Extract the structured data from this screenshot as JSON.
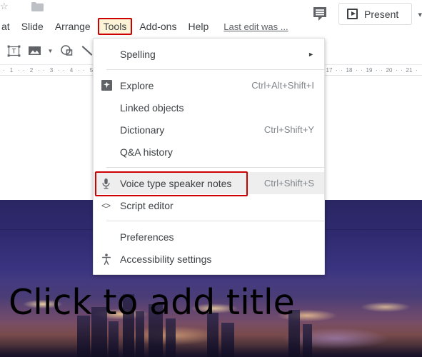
{
  "app": "Google Slides",
  "topbar": {
    "star_icon": "star-icon",
    "folder_icon": "folder-icon",
    "comment_icon": "comment-icon",
    "present_label": "Present",
    "present_icon": "play-button-icon",
    "present_caret": "▾"
  },
  "menubar": {
    "items": [
      {
        "label": "at",
        "name": "menu-format-clipped",
        "highlighted": false
      },
      {
        "label": "Slide",
        "name": "menu-slide",
        "highlighted": false
      },
      {
        "label": "Arrange",
        "name": "menu-arrange",
        "highlighted": false
      },
      {
        "label": "Tools",
        "name": "menu-tools",
        "highlighted": true
      },
      {
        "label": "Add-ons",
        "name": "menu-addons",
        "highlighted": false
      },
      {
        "label": "Help",
        "name": "menu-help",
        "highlighted": false
      }
    ],
    "last_edit": "Last edit was ..."
  },
  "toolbar": {
    "buttons": [
      {
        "name": "text-box-icon",
        "glyph": "T"
      },
      {
        "name": "insert-image-icon",
        "glyph": "image"
      },
      {
        "name": "image-dropdown-caret",
        "glyph": "▾"
      },
      {
        "name": "shape-icon",
        "glyph": "shape"
      },
      {
        "name": "line-icon",
        "glyph": "line"
      }
    ]
  },
  "ruler": {
    "left_numbers": [
      "1",
      "2",
      "3",
      "4",
      "5"
    ],
    "right_numbers": [
      "17",
      "18",
      "19",
      "20",
      "21"
    ]
  },
  "tools_menu": {
    "title": "Tools",
    "items": [
      {
        "label": "Spelling",
        "shortcut": "",
        "icon": "",
        "submenu": "►",
        "active": false,
        "ringed": false,
        "name": "menu-item-spelling"
      },
      {
        "separator": true
      },
      {
        "label": "Explore",
        "shortcut": "Ctrl+Alt+Shift+I",
        "icon": "explore-icon",
        "submenu": "",
        "active": false,
        "ringed": false,
        "name": "menu-item-explore"
      },
      {
        "label": "Linked objects",
        "shortcut": "",
        "icon": "",
        "submenu": "",
        "active": false,
        "ringed": false,
        "name": "menu-item-linked-objects"
      },
      {
        "label": "Dictionary",
        "shortcut": "Ctrl+Shift+Y",
        "icon": "",
        "submenu": "",
        "active": false,
        "ringed": false,
        "name": "menu-item-dictionary"
      },
      {
        "label": "Q&A history",
        "shortcut": "",
        "icon": "",
        "submenu": "",
        "active": false,
        "ringed": false,
        "name": "menu-item-qa-history"
      },
      {
        "separator": true
      },
      {
        "label": "Voice type speaker notes",
        "shortcut": "Ctrl+Shift+S",
        "icon": "microphone-icon",
        "submenu": "",
        "active": true,
        "ringed": true,
        "name": "menu-item-voice-type-speaker-notes"
      },
      {
        "label": "Script editor",
        "shortcut": "",
        "icon": "code-icon",
        "submenu": "",
        "active": false,
        "ringed": false,
        "name": "menu-item-script-editor"
      },
      {
        "separator": true
      },
      {
        "label": "Preferences",
        "shortcut": "",
        "icon": "",
        "submenu": "",
        "active": false,
        "ringed": false,
        "name": "menu-item-preferences"
      },
      {
        "label": "Accessibility settings",
        "shortcut": "",
        "icon": "accessibility-icon",
        "submenu": "",
        "active": false,
        "ringed": false,
        "name": "menu-item-accessibility-settings"
      }
    ]
  },
  "slide": {
    "title_placeholder": "Click to add title",
    "background": "cityscape-night-photo"
  },
  "colors": {
    "highlight_border": "#cc0000",
    "menu_highlight_bg": "#fdf3d7",
    "active_item_bg": "#eeeeee",
    "text_primary": "#3c4043",
    "text_secondary": "#80868b"
  }
}
